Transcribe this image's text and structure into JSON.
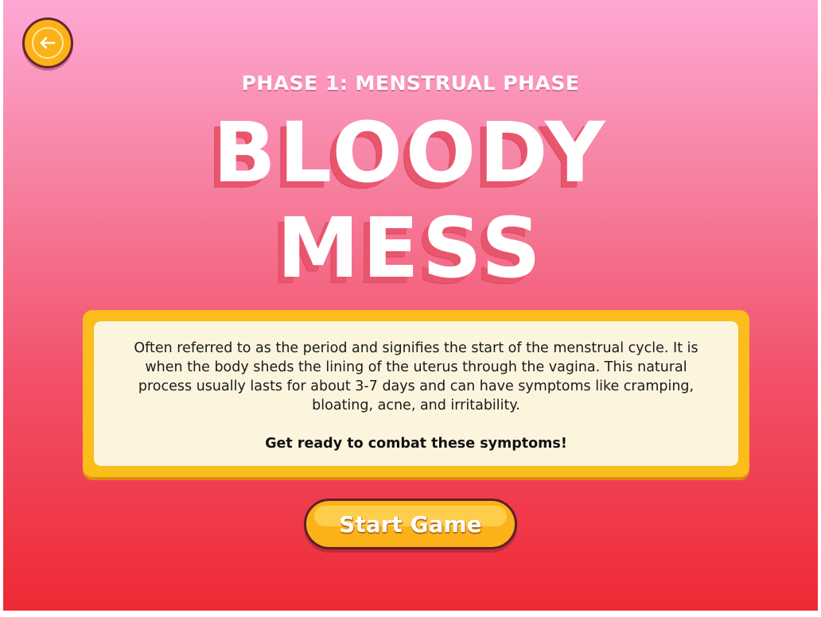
{
  "back_button": {
    "icon": "arrow-left-icon",
    "color": "#fbb218"
  },
  "header": {
    "phase_label": "PHASE 1: MENSTRUAL PHASE",
    "title_line_1": "BLOODY",
    "title_line_2": "MESS"
  },
  "info_panel": {
    "description": "Often referred to as the period and signifies the start of the menstrual cycle. It is when the body sheds the lining of the uterus through the vagina. This natural process usually lasts for about 3-7 days and can have symptoms like cramping, bloating, acne, and irritability.",
    "callout": "Get ready to combat these symptoms!"
  },
  "start_button": {
    "label": "Start Game"
  },
  "colors": {
    "background_top": "#fea8d4",
    "background_bottom": "#ee2a34",
    "accent_yellow": "#fbbd1c",
    "panel_cream": "#fdf4de",
    "title_shadow": "#e8566e"
  }
}
